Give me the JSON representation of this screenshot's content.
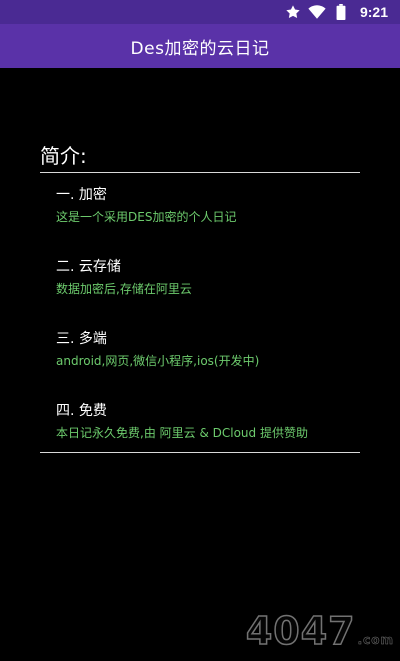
{
  "status_bar": {
    "time": "9:21",
    "icons": [
      "star-icon",
      "wifi-icon",
      "battery-icon"
    ]
  },
  "app_bar": {
    "title": "Des加密的云日记"
  },
  "intro": {
    "heading": "简介:",
    "sections": [
      {
        "title": "一. 加密",
        "desc": "这是一个采用DES加密的个人日记"
      },
      {
        "title": "二. 云存储",
        "desc": "数据加密后,存储在阿里云"
      },
      {
        "title": "三. 多端",
        "desc": "android,网页,微信小程序,ios(开发中)"
      },
      {
        "title": "四. 免费",
        "desc": "本日记永久免费,由 阿里云 & DCloud 提供赞助"
      }
    ]
  },
  "watermark": {
    "text": "4047",
    "domain": ".com"
  },
  "colors": {
    "status_bar": "#4a2a93",
    "app_bar": "#5a32a8",
    "background": "#000000",
    "desc_text": "#6dcb6d"
  }
}
